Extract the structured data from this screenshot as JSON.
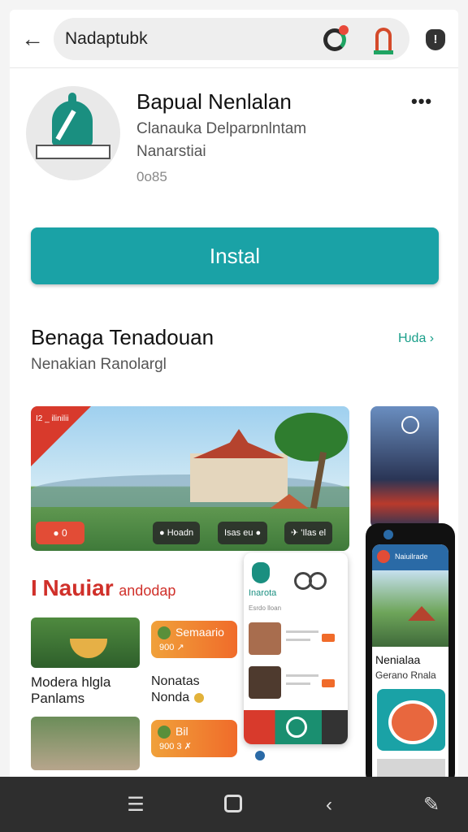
{
  "search": {
    "value": "Nadaptubk"
  },
  "app": {
    "title": "Bapual Nenlalan",
    "developer": "Clanauka Delparɒnlntam",
    "category": "Nanarstiai",
    "rating_text": "0o85",
    "more_label": "•••",
    "install_label": "Instal"
  },
  "section": {
    "title": "Benaga Tenadouan",
    "subtitle": "Nenakian Ranolargl",
    "more_label": "Ƕda ›"
  },
  "banner": {
    "corner_text": "I2 _ ilinilii",
    "pill_left": "● 0",
    "pill_1": "● Hoadn",
    "pill_2": "Isas eu ●",
    "pill_3": "✈ 'Ilas el"
  },
  "promo": {
    "prefix": "I",
    "title": "Nauiar",
    "suffix": "andodap"
  },
  "items": [
    {
      "caption_1": "Modera hlgla",
      "caption_2": "Panlams",
      "chip_title": "Semaario",
      "chip_value": "900 ↗"
    },
    {
      "caption_1": "Nonatas",
      "caption_2": "Nonda",
      "chip_title": "Bil",
      "chip_value": "900 3 ✗"
    }
  ],
  "card": {
    "name": "Inarota",
    "subtitle": "Esrdo lloan"
  },
  "phone": {
    "header": "Naiuilrade",
    "title": "Nenialaa",
    "subtitle": "Gerano Rnala"
  },
  "nav": {
    "menu_icon": "☰",
    "back_icon": "‹",
    "edit_icon": "✎"
  },
  "colors": {
    "accent": "#1aa2a6",
    "brand_red": "#d0302a",
    "nav_bg": "#2e2e2e"
  }
}
